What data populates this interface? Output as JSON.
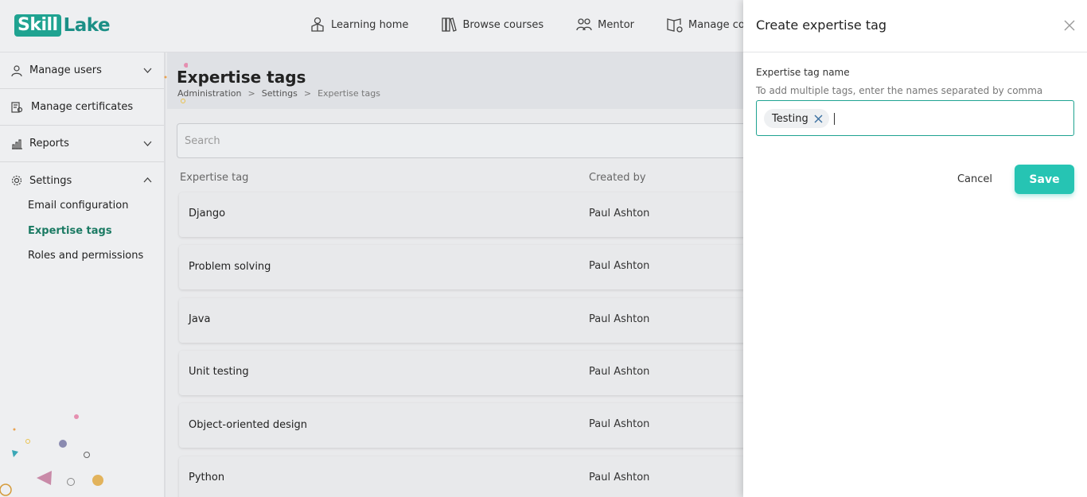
{
  "logo": {
    "part1": "Skill",
    "part2": "Lake"
  },
  "topnav": [
    {
      "label": "Learning home",
      "icon": "graduate-icon"
    },
    {
      "label": "Browse courses",
      "icon": "books-icon"
    },
    {
      "label": "Mentor",
      "icon": "people-icon"
    },
    {
      "label": "Manage co",
      "icon": "manage-book-icon"
    }
  ],
  "sidebar": {
    "sections": [
      {
        "label": "Manage users",
        "icon": "user-icon",
        "expanded": false
      },
      {
        "label": "Manage certificates",
        "icon": "certificate-icon"
      },
      {
        "label": "Reports",
        "icon": "chart-icon",
        "expanded": false
      },
      {
        "label": "Settings",
        "icon": "gear-icon",
        "expanded": true
      }
    ],
    "settings_items": [
      {
        "label": "Email configuration",
        "active": false
      },
      {
        "label": "Expertise tags",
        "active": true
      },
      {
        "label": "Roles and permissions",
        "active": false
      }
    ]
  },
  "page": {
    "title": "Expertise tags",
    "breadcrumb": [
      "Administration",
      "Settings",
      "Expertise tags"
    ],
    "search_placeholder": "Search"
  },
  "table": {
    "columns": [
      "Expertise tag",
      "Created by"
    ],
    "rows": [
      {
        "tag": "Django",
        "created_by": "Paul Ashton"
      },
      {
        "tag": "Problem solving",
        "created_by": "Paul Ashton"
      },
      {
        "tag": "Java",
        "created_by": "Paul Ashton"
      },
      {
        "tag": "Unit testing",
        "created_by": "Paul Ashton"
      },
      {
        "tag": "Object-oriented design",
        "created_by": "Paul Ashton"
      },
      {
        "tag": "Python",
        "created_by": "Paul Ashton"
      }
    ]
  },
  "drawer": {
    "title": "Create expertise tag",
    "field_label": "Expertise tag name",
    "field_hint": "To add multiple tags, enter the names separated by comma",
    "chips": [
      "Testing"
    ],
    "cancel_label": "Cancel",
    "save_label": "Save"
  },
  "colors": {
    "accent": "#26c4b3",
    "brand": "#1fa391",
    "active_nav": "#1b7a63"
  }
}
